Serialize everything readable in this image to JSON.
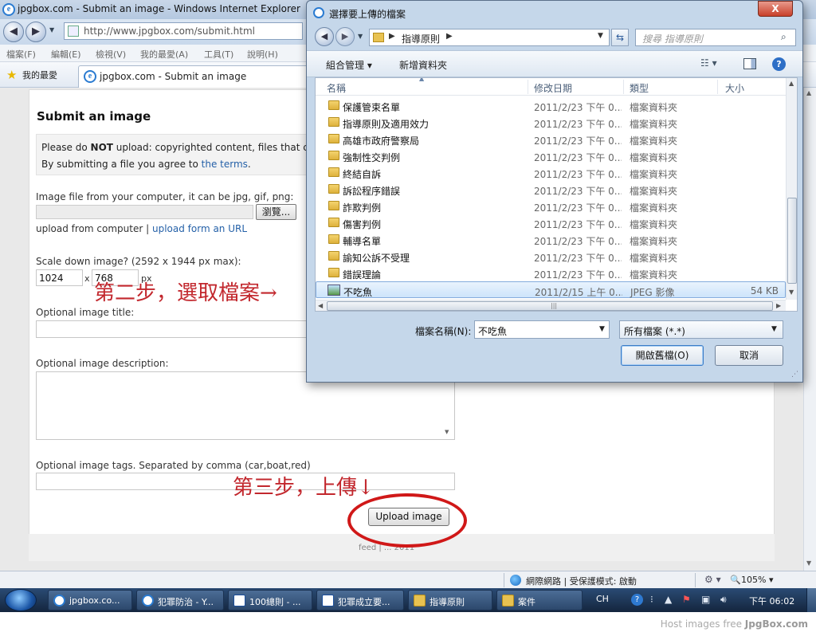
{
  "browser": {
    "window_title": "jpgbox.com - Submit an image - Windows Internet Explorer",
    "address": "http://www.jpgbox.com/submit.html",
    "menu": [
      "檔案(F)",
      "編輯(E)",
      "檢視(V)",
      "我的最愛(A)",
      "工具(T)",
      "說明(H)"
    ],
    "favorites_label": "我的最愛",
    "tab_title": "jpgbox.com - Submit an image",
    "status_zone": "網際網路 | 受保護模式: 啟動",
    "zoom": "105%"
  },
  "page": {
    "heading": "Submit an image",
    "notice_prefix": "Please do ",
    "notice_bold": "NOT",
    "notice_rest": " upload: copyrighted content, files that contain",
    "terms_prefix": "By submitting a file you agree to ",
    "terms_link": "the terms",
    "terms_suffix": ".",
    "file_label": "Image file from your computer, it can be jpg, gif, png:",
    "browse_label": "瀏覽...",
    "upload_from_computer": "upload from computer",
    "pipe": " | ",
    "upload_url_link": "upload form an URL",
    "scale_label": "Scale down image? (2592 x 1944 px max):",
    "scale_width": "1024",
    "scale_x": "x",
    "scale_height": "768",
    "scale_unit": "px",
    "title_label": "Optional image title:",
    "desc_label": "Optional image description:",
    "tags_label": "Optional image tags. Separated by comma (car,boat,red)",
    "upload_button": "Upload image",
    "footer": "feed | ... 2011"
  },
  "annotations": {
    "step2": "第二步，選取檔案→",
    "step3": "第三步，上傳↓"
  },
  "dialog": {
    "title": "選擇要上傳的檔案",
    "close": "X",
    "breadcrumb": "指導原則",
    "search_placeholder": "搜尋 指導原則",
    "organize": "組合管理",
    "new_folder": "新增資料夾",
    "columns": {
      "name": "名稱",
      "date": "修改日期",
      "type": "類型",
      "size": "大小"
    },
    "files": [
      {
        "name": "保護管束名單",
        "date": "2011/2/23 下午 0...",
        "type": "檔案資料夾",
        "size": "",
        "kind": "folder"
      },
      {
        "name": "指導原則及適用效力",
        "date": "2011/2/23 下午 0...",
        "type": "檔案資料夾",
        "size": "",
        "kind": "folder"
      },
      {
        "name": "高雄市政府警察局",
        "date": "2011/2/23 下午 0...",
        "type": "檔案資料夾",
        "size": "",
        "kind": "folder"
      },
      {
        "name": "強制性交判例",
        "date": "2011/2/23 下午 0...",
        "type": "檔案資料夾",
        "size": "",
        "kind": "folder"
      },
      {
        "name": "終結自訴",
        "date": "2011/2/23 下午 0...",
        "type": "檔案資料夾",
        "size": "",
        "kind": "folder"
      },
      {
        "name": "訴訟程序錯誤",
        "date": "2011/2/23 下午 0...",
        "type": "檔案資料夾",
        "size": "",
        "kind": "folder"
      },
      {
        "name": "詐欺判例",
        "date": "2011/2/23 下午 0...",
        "type": "檔案資料夾",
        "size": "",
        "kind": "folder"
      },
      {
        "name": "傷害判例",
        "date": "2011/2/23 下午 0...",
        "type": "檔案資料夾",
        "size": "",
        "kind": "folder"
      },
      {
        "name": "輔導名單",
        "date": "2011/2/23 下午 0...",
        "type": "檔案資料夾",
        "size": "",
        "kind": "folder"
      },
      {
        "name": "諭知公訴不受理",
        "date": "2011/2/23 下午 0...",
        "type": "檔案資料夾",
        "size": "",
        "kind": "folder"
      },
      {
        "name": "錯誤理論",
        "date": "2011/2/23 下午 0...",
        "type": "檔案資料夾",
        "size": "",
        "kind": "folder"
      },
      {
        "name": "不吃魚",
        "date": "2011/2/15 上午 0...",
        "type": "JPEG 影像",
        "size": "54 KB",
        "kind": "jpeg"
      }
    ],
    "selected_index": 11,
    "filename_label": "檔案名稱(N):",
    "filename_value": "不吃魚",
    "filetype_value": "所有檔案 (*.*)",
    "open_button": "開啟舊檔(O)",
    "cancel_button": "取消"
  },
  "taskbar": {
    "items": [
      {
        "label": "jpgbox.co...",
        "icon": "ie-icon"
      },
      {
        "label": "犯罪防治 - Y...",
        "icon": "ie-icon"
      },
      {
        "label": "100總則 - ...",
        "icon": "word-icon"
      },
      {
        "label": "犯罪成立要...",
        "icon": "word-icon"
      },
      {
        "label": "指導原則",
        "icon": "folder-icon"
      },
      {
        "label": "案件",
        "icon": "folder-icon"
      }
    ],
    "lang": "CH",
    "clock": "下午 06:02"
  },
  "watermark": {
    "prefix": "Host images free ",
    "brand": "JpgBox.com"
  }
}
